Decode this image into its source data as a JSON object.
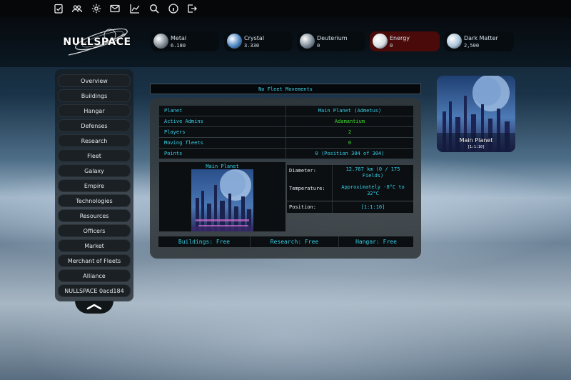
{
  "topbar": {
    "icons": [
      "clipboard-check-icon",
      "users-icon",
      "gear-icon",
      "mail-icon",
      "chart-line-icon",
      "search-icon",
      "info-icon",
      "logout-icon"
    ]
  },
  "brand": {
    "logo_text": "NULLSPACE"
  },
  "resources": [
    {
      "name": "Metal",
      "value": "6.180",
      "color": "#7f8a92",
      "alert": false
    },
    {
      "name": "Crystal",
      "value": "3.330",
      "color": "#4b86c4",
      "alert": false
    },
    {
      "name": "Deuterium",
      "value": "0",
      "color": "#7c8a96",
      "alert": false
    },
    {
      "name": "Energy",
      "value": "0",
      "color": "#d8dde2",
      "alert": true
    },
    {
      "name": "Dark Matter",
      "value": "2,500",
      "color": "#a9c4d8",
      "alert": false
    }
  ],
  "sidebar": {
    "items": [
      "Overview",
      "Buildings",
      "Hangar",
      "Defenses",
      "Research",
      "Fleet",
      "Galaxy",
      "Empire",
      "Technologies",
      "Resources",
      "Officers",
      "Market",
      "Merchant of Fleets",
      "Alliance",
      "NULLSPACE 0acd184"
    ]
  },
  "fleet": {
    "status": "No Fleet Movements"
  },
  "overview": {
    "rows": [
      {
        "label": "Planet",
        "value": "Main Planet (Admetus)",
        "accent": "cyan"
      },
      {
        "label": "Active Admins",
        "value": "Adamantium",
        "accent": "green"
      },
      {
        "label": "Players",
        "value": "2",
        "accent": "green"
      },
      {
        "label": "Moving fleets",
        "value": "0",
        "accent": "green"
      },
      {
        "label": "Points",
        "value": "0 (Position 304 of 304)",
        "accent": "cyan"
      }
    ],
    "planet_image_title": "Main Planet",
    "details": [
      {
        "label": "Diameter:",
        "value_lines": [
          "12.767 km (0 / 175",
          "Fields)"
        ]
      },
      {
        "label": "Temperature:",
        "value_lines": [
          "Approximately -8°C to",
          "32°C"
        ]
      },
      {
        "label": "Position:",
        "value_lines": [
          "[1:1:10]"
        ]
      }
    ],
    "status": {
      "buildings": "Buildings: Free",
      "research": "Research: Free",
      "hangar": "Hangar: Free"
    }
  },
  "planet_card": {
    "name": "Main Planet",
    "coords": "[1:1:10]"
  },
  "colors": {
    "cyan": "#35cde6",
    "green": "#3fdc2f",
    "energy_alert": "#4a0a0a"
  }
}
